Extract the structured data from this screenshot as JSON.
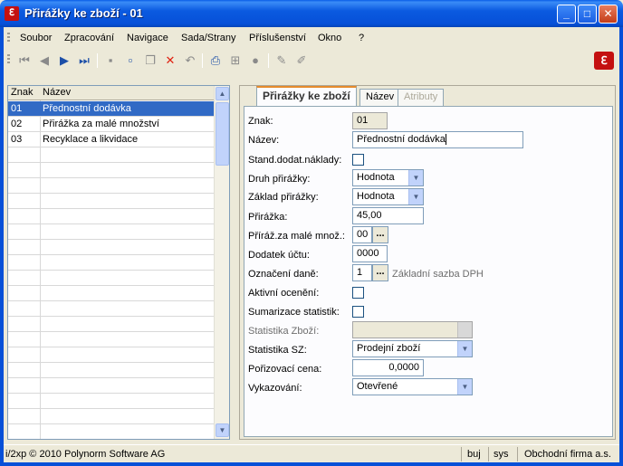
{
  "window": {
    "title": "Přirážky ke zboží - 01",
    "app_icon_glyph": "ℇ",
    "min_glyph": "_",
    "max_glyph": "□",
    "close_glyph": "✕"
  },
  "menu": [
    "Soubor",
    "Zpracování",
    "Navigace",
    "Sada/Strany",
    "Příslušenství",
    "Okno",
    "?"
  ],
  "toolbar": {
    "icons": [
      "first-record-icon",
      "prev-record-icon",
      "next-record-icon",
      "last-record-icon",
      "save-icon",
      "new-icon",
      "copy-icon",
      "delete-icon",
      "undo-icon",
      "print-icon",
      "tree-icon",
      "lock-icon",
      "edit-icon",
      "edit-all-icon"
    ],
    "glyphs": {
      "first": "⏮",
      "prev": "◀",
      "next": "▶",
      "last": "⏭",
      "save": "▪",
      "new": "▫",
      "copy": "❐",
      "delete": "✕",
      "undo": "↶",
      "print": "⎙",
      "tree": "⊞",
      "lock": "●",
      "edit": "✎",
      "edit_all": "✐"
    },
    "brand_glyph": "ℇ"
  },
  "grid": {
    "columns": [
      "Znak",
      "Název"
    ],
    "rows": [
      {
        "znak": "01",
        "nazev": "Přednostní dodávka"
      },
      {
        "znak": "02",
        "nazev": "Přirážka za malé množství"
      },
      {
        "znak": "03",
        "nazev": "Recyklace a likvidace"
      }
    ],
    "selected_index": 0,
    "scroll_up": "▲",
    "scroll_down": "▼"
  },
  "tabs": [
    {
      "label": "Přirážky ke zboží",
      "state": "active"
    },
    {
      "label": "Název",
      "state": "normal"
    },
    {
      "label": "Atributy",
      "state": "disabled"
    }
  ],
  "form": {
    "znak": {
      "label": "Znak:",
      "value": "01"
    },
    "nazev": {
      "label": "Název:",
      "value": "Přednostní dodávka"
    },
    "stand_naklady": {
      "label": "Stand.dodat.náklady:",
      "checked": false
    },
    "druh_prirazky": {
      "label": "Druh přirážky:",
      "value": "Hodnota"
    },
    "zaklad_prirazky": {
      "label": "Základ přirážky:",
      "value": "Hodnota"
    },
    "prirazka": {
      "label": "Přirážka:",
      "value": "45,00"
    },
    "priraz_male": {
      "label": "Příráž.za malé množ.:",
      "value": "00"
    },
    "dodatek_uctu": {
      "label": "Dodatek účtu:",
      "value": "0000"
    },
    "oznaceni_dane": {
      "label": "Označení daně:",
      "value": "1",
      "hint": "Základní sazba DPH"
    },
    "aktivni_oceneni": {
      "label": "Aktivní ocenění:",
      "checked": false
    },
    "sumarizace": {
      "label": "Sumarizace statistik:",
      "checked": false
    },
    "statistika_zbozi": {
      "label": "Statistika Zboží:",
      "value": ""
    },
    "statistika_sz": {
      "label": "Statistika SZ:",
      "value": "Prodejní zboží"
    },
    "porizovaci_cena": {
      "label": "Pořizovací cena:",
      "value": "0,0000"
    },
    "vykazovani": {
      "label": "Vykazování:",
      "value": "Otevřené"
    },
    "combo_glyph": "▼",
    "dots_glyph": "..."
  },
  "status": {
    "copyright": "i/2xp © 2010 Polynorm Software AG",
    "user": "buj",
    "system": "sys",
    "company": "Obchodní firma a.s."
  },
  "colors": {
    "titlebar": "#0650d8",
    "selection": "#316ac5",
    "brand": "#c41010",
    "active_tab_accent": "#e68b2c"
  }
}
